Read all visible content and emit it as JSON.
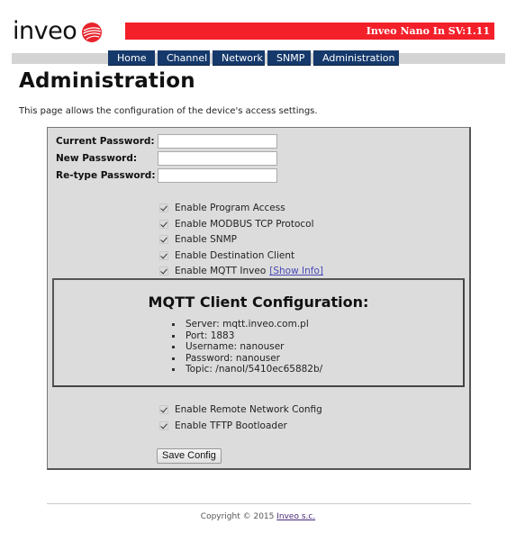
{
  "header": {
    "logo_text": "inveo",
    "logo_icon": "inveo-ball-logo-icon",
    "device_title": "Inveo Nano In SV:1.11",
    "brand_color": "#f3202a"
  },
  "nav": {
    "items": [
      {
        "label": "Home"
      },
      {
        "label": "Channel"
      },
      {
        "label": "Network"
      },
      {
        "label": "SNMP"
      },
      {
        "label": "Administration"
      }
    ],
    "active": "Administration",
    "color": "#15396b"
  },
  "page": {
    "title": "Administration",
    "intro": "This page allows the configuration of the device's access settings."
  },
  "form": {
    "passwords": [
      {
        "label": "Current Password:",
        "value": ""
      },
      {
        "label": "New Password:",
        "value": ""
      },
      {
        "label": "Re-type Password:",
        "value": ""
      }
    ],
    "options": [
      {
        "label": "Enable Program Access",
        "checked": true
      },
      {
        "label": "Enable MODBUS TCP Protocol",
        "checked": true
      },
      {
        "label": "Enable SNMP",
        "checked": true
      },
      {
        "label": "Enable Destination Client",
        "checked": true
      },
      {
        "label": "Enable MQTT Inveo",
        "checked": true,
        "link": "[Show Info]"
      }
    ],
    "mqtt": {
      "title": "MQTT Client Configuration:",
      "items": [
        "Server: mqtt.inveo.com.pl",
        "Port: 1883",
        "Username: nanouser",
        "Password: nanouser",
        "Topic: /nanoI/5410ec65882b/"
      ]
    },
    "options_after": [
      {
        "label": "Enable Remote Network Config",
        "checked": true
      },
      {
        "label": "Enable TFTP Bootloader",
        "checked": true
      }
    ],
    "save_label": "Save Config"
  },
  "footer": {
    "copyright": "Copyright © 2015 ",
    "company_link": "Inveo s.c."
  }
}
